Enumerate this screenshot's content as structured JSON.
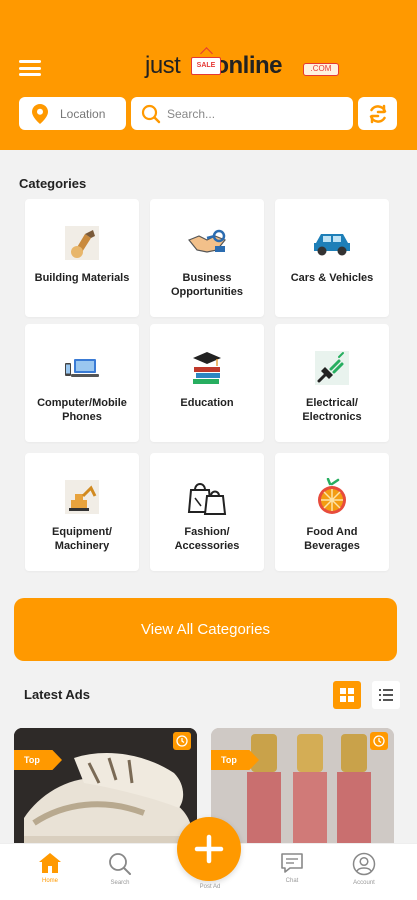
{
  "header": {
    "logo_just": "just",
    "logo_online": "online",
    "logo_tag": "SALE",
    "logo_com": ".COM",
    "location_label": "Location",
    "search_placeholder": "Search..."
  },
  "categories": {
    "title": "Categories",
    "items": [
      {
        "label": "Building Materials",
        "icon": "building-materials-icon"
      },
      {
        "label": "Business Opportunities",
        "icon": "handshake-key-icon"
      },
      {
        "label": "Cars & Vehicles",
        "icon": "car-icon"
      },
      {
        "label": "Computer/Mobile Phones",
        "icon": "computer-phone-icon"
      },
      {
        "label": "Education",
        "icon": "books-graduation-icon"
      },
      {
        "label": "Electrical/ Electronics",
        "icon": "plug-icon"
      },
      {
        "label": "Equipment/ Machinery",
        "icon": "excavator-icon"
      },
      {
        "label": "Fashion/ Accessories",
        "icon": "shopping-bag-icon"
      },
      {
        "label": "Food And Beverages",
        "icon": "orange-fruit-icon"
      }
    ],
    "view_all_label": "View All Categories"
  },
  "latest_ads": {
    "title": "Latest Ads",
    "ads": [
      {
        "badge": "Top"
      },
      {
        "badge": "Top"
      }
    ]
  },
  "bottom_nav": {
    "home": "Home",
    "search": "Search",
    "post_ad": "Post Ad",
    "chat": "Chat",
    "account": "Account"
  },
  "colors": {
    "brand": "#ff9900",
    "background": "#f2f2f2",
    "logo_red": "#e53935"
  }
}
